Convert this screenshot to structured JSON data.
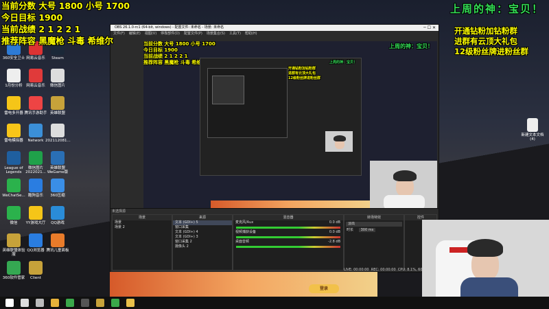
{
  "overlay_left": {
    "line1": "当前分数 大号 1800 小号 1700",
    "line2": "今日目标 1900",
    "line3": "当前战绩 2 1 2 2 1",
    "line4": "推荐阵容 黑魔枪 斗毒 希维尔"
  },
  "overlay_right_title": "上周的神：宝贝！",
  "overlay_right": {
    "line1": "开通钻粉加钻粉群",
    "line2": "进群有云顶大礼包",
    "line3": "12级粉丝牌进粉丝群"
  },
  "desktop_icons": [
    {
      "label": "360安全卫士",
      "color": "#2d7bd6"
    },
    {
      "label": "网易云音乐",
      "color": "#d33"
    },
    {
      "label": "Steam",
      "color": "#1b2838"
    },
    {
      "label": "1月份分析",
      "color": "#eee"
    },
    {
      "label": "网易云音乐",
      "color": "#e03a3a"
    },
    {
      "label": "微信图片",
      "color": "#ddd"
    },
    {
      "label": "雷电多开器",
      "color": "#f5c518"
    },
    {
      "label": "腾讯手游助手",
      "color": "#e44"
    },
    {
      "label": "英雄联盟",
      "color": "#c7a23a"
    },
    {
      "label": "雷电模拟器",
      "color": "#f7c519"
    },
    {
      "label": "Network",
      "color": "#3b8fd8"
    },
    {
      "label": "202112081...",
      "color": "#ddd"
    },
    {
      "label": "League of Legends",
      "color": "#1f5f9f"
    },
    {
      "label": "微信图片 2022021...",
      "color": "#1fa14a"
    },
    {
      "label": "英雄联盟 WeGame版",
      "color": "#2a6fb5"
    },
    {
      "label": "WeChatSe...",
      "color": "#2bb24c"
    },
    {
      "label": "酷狗音乐",
      "color": "#2a7de1"
    },
    {
      "label": "360压缩",
      "color": "#3a8ee6"
    },
    {
      "label": "微信",
      "color": "#2bb24c"
    },
    {
      "label": "YY游戏大厅",
      "color": "#f5c518"
    },
    {
      "label": "QQ游戏",
      "color": "#2a8cd8"
    },
    {
      "label": "英雄联盟体验服",
      "color": "#c7a23a"
    },
    {
      "label": "QQ浏览器",
      "color": "#2a7de1"
    },
    {
      "label": "腾讯儿童面板",
      "color": "#e87b2a"
    },
    {
      "label": "360软件管家",
      "color": "#35a852"
    },
    {
      "label": "Client",
      "color": "#c7a23a"
    }
  ],
  "right_desktop_icon": {
    "label": "新建文本文档 (4)"
  },
  "obs": {
    "title": "OBS 26.1.0-rc1 (64-bit, windows) - 配置文件: 未命名 - 场景: 未命名",
    "menu": [
      "文件(F)",
      "编辑(E)",
      "视图(V)",
      "停靠部件(D)",
      "配置文件(P)",
      "场景集合(S)",
      "工具(T)",
      "帮助(H)"
    ],
    "no_source": "未选择源",
    "docks": {
      "scenes": "场景",
      "sources": "来源",
      "mixer": "混音器",
      "transitions": "转场特效",
      "controls": "控件"
    },
    "scenes": [
      "场景",
      "场景 2"
    ],
    "sources": [
      "文本 (GDI+) 5",
      "窗口采集",
      "文本 (GDI+) 4",
      "文本 (GDI+) 3",
      "窗口采集 2",
      "摄像头 2"
    ],
    "mixer": [
      {
        "name": "麦克风/Aux",
        "level": "0.0 dB"
      },
      {
        "name": "视频捕获设备",
        "level": "0.0 dB"
      },
      {
        "name": "桌面音频",
        "level": "-2.8 dB"
      }
    ],
    "transition": {
      "type": "淡出",
      "duration_label": "时长",
      "duration": "300 ms"
    },
    "status": {
      "live": "LIVE: 00:00:00",
      "rec": "REC: 00:00:00",
      "cpu": "CPU: 8.1%, 60.00 fps"
    }
  },
  "preview_button": "登录",
  "taskbar_icons": [
    "start-icon",
    "search-icon",
    "task-view-icon",
    "explorer-icon",
    "chrome-icon",
    "obs-icon",
    "league-icon",
    "chrome-icon-2",
    "folder-icon"
  ],
  "colors": {
    "overlay_yellow": "#ffff00",
    "overlay_green": "#33dd55",
    "obs_bg": "#2b2b2b"
  }
}
